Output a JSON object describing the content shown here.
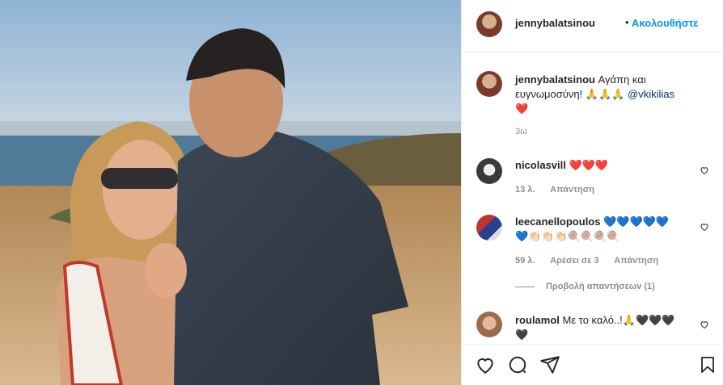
{
  "post": {
    "photo_alt": "",
    "author": {
      "username": "jennybalatsinou",
      "follow_label": "Ακολουθήστε",
      "separator": "•"
    },
    "caption": {
      "username": "jennybalatsinou",
      "text": "Αγάπη και ευγνωμοσύνη! 🙏🙏🙏",
      "mention": "@vkikilias",
      "emoji_line": "❤️",
      "time": "3ω"
    },
    "comments": [
      {
        "username": "nicolasvill",
        "text": "❤️❤️❤️",
        "time": "13 λ.",
        "reply_label": "Απάντηση"
      },
      {
        "username": "leecanellopoulos",
        "text": "💙💙💙💙💙",
        "text2": "💙👏🏻👏🏻👏🏻🍭🍭🍭🍭",
        "time": "59 λ.",
        "likes": "Αρέσει σε 3",
        "reply_label": "Απάντηση"
      },
      {
        "username": "roulamol",
        "text": "Με το καλό..!🙏🖤🖤🖤",
        "text2": "🖤"
      }
    ],
    "view_replies": "Προβολή απαντήσεων (1)"
  },
  "icons": {
    "like": "heart-icon",
    "comment": "comment-icon",
    "share": "share-icon",
    "save": "bookmark-icon"
  },
  "colors": {
    "link_blue": "#0095f6",
    "mention": "#00376b",
    "muted": "#8e8e8e",
    "heart_red": "#e0202a"
  }
}
